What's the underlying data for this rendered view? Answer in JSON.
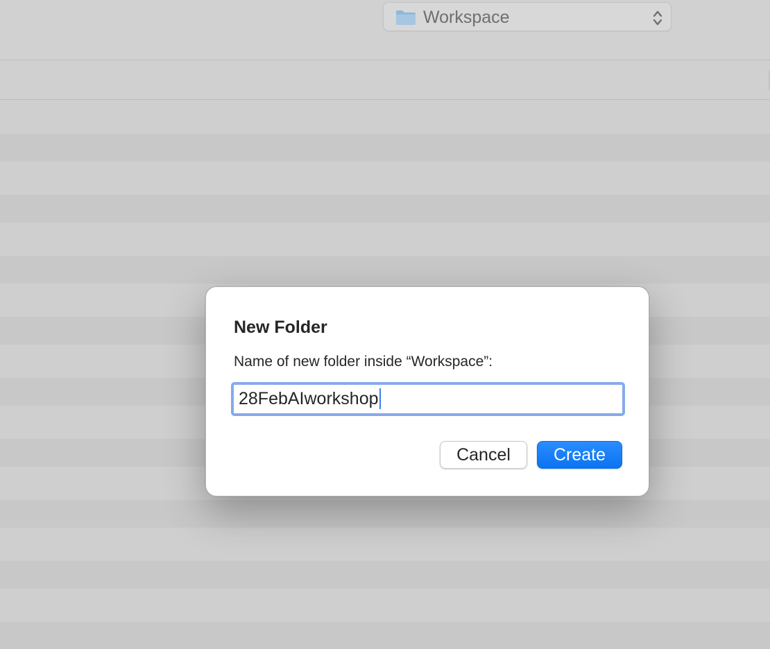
{
  "background": {
    "location_popup": {
      "label": "Workspace",
      "icon": "folder-icon",
      "indicator_icon": "updown-chevron-icon"
    }
  },
  "dialog": {
    "title": "New Folder",
    "prompt": "Name of new folder inside “Workspace”:",
    "name_field": {
      "value": "28FebAIworkshop"
    },
    "buttons": {
      "cancel_label": "Cancel",
      "create_label": "Create"
    }
  },
  "colors": {
    "accent": "#0b74f0",
    "focus_ring": "#86a9ec",
    "folder": "#8ab4d8"
  }
}
